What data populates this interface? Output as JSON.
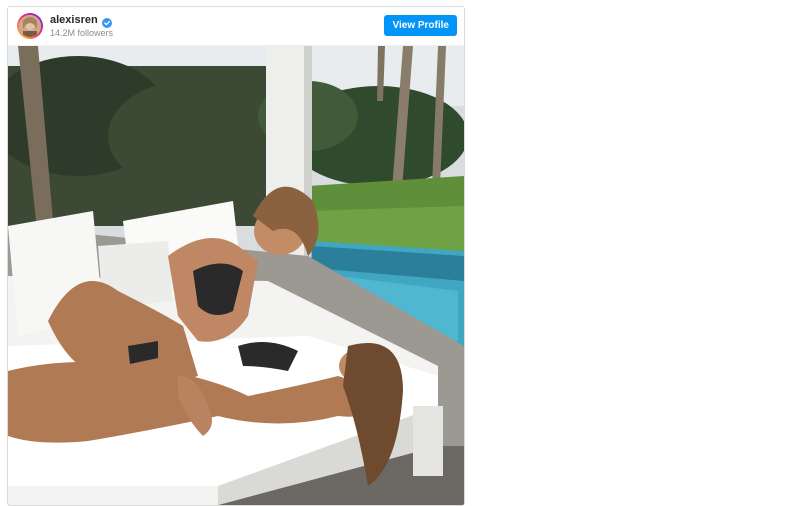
{
  "profile": {
    "username": "alexisren",
    "followers": "14.2M followers",
    "verified": true,
    "view_profile_label": "View Profile"
  },
  "post": {
    "media_type": "photo"
  },
  "colors": {
    "accent": "#0095f6",
    "border": "#dbdbdb",
    "muted_text": "#8e8e8e"
  },
  "icons": {
    "verified": "verified-badge-icon",
    "avatar": "profile-avatar"
  }
}
